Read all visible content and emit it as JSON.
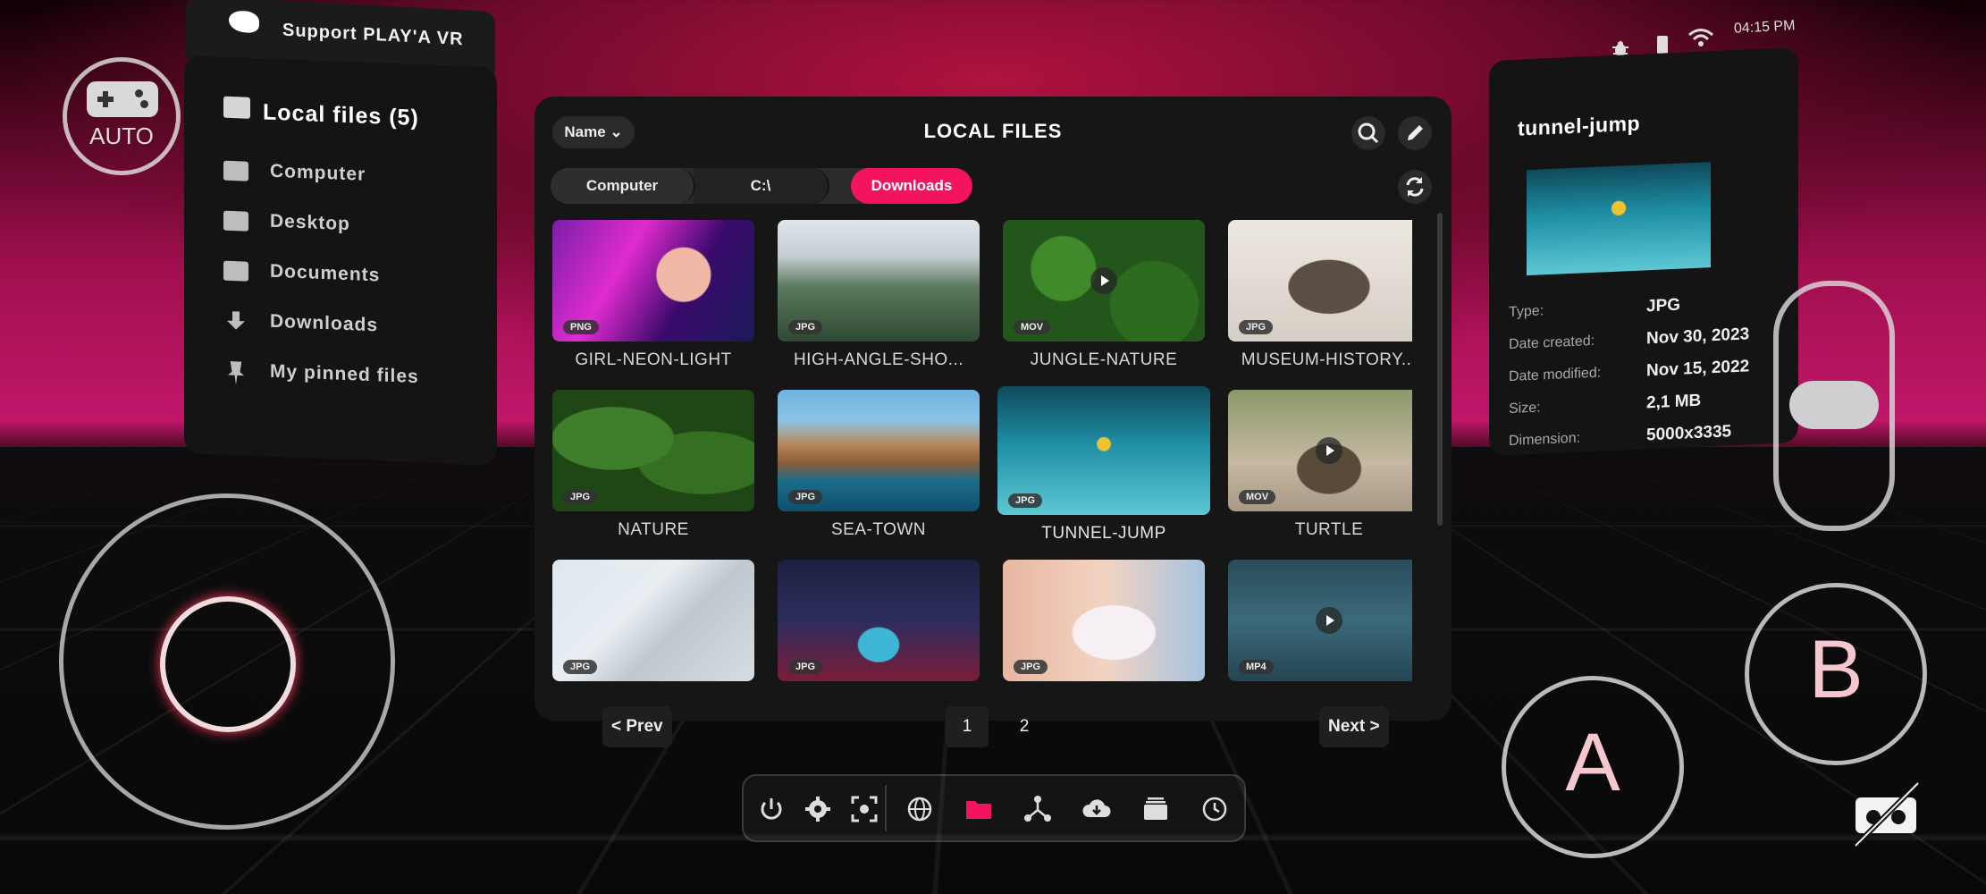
{
  "status_bar": {
    "time": "04:15 PM",
    "icons": [
      "bug-icon",
      "battery-icon",
      "wifi-icon"
    ]
  },
  "support": {
    "label": "Support PLAY'A VR",
    "icon": "patreon-icon"
  },
  "sidebar": {
    "title": "Local files (5)",
    "items": [
      {
        "label": "Computer",
        "icon": "monitor-icon"
      },
      {
        "label": "Desktop",
        "icon": "desktop-icon"
      },
      {
        "label": "Documents",
        "icon": "folder-icon"
      },
      {
        "label": "Downloads",
        "icon": "download-icon"
      },
      {
        "label": "My pinned files",
        "icon": "pin-icon"
      }
    ]
  },
  "browser": {
    "title": "LOCAL FILES",
    "sort_label": "Name",
    "breadcrumbs": [
      "Computer",
      "C:\\",
      "Downloads"
    ],
    "files": [
      {
        "name": "GIRL-NEON-LIGHT",
        "type": "PNG",
        "video": false
      },
      {
        "name": "HIGH-ANGLE-SHO...",
        "type": "JPG",
        "video": false
      },
      {
        "name": "JUNGLE-NATURE",
        "type": "MOV",
        "video": true
      },
      {
        "name": "MUSEUM-HISTORY...",
        "type": "JPG",
        "video": false
      },
      {
        "name": "NATURE",
        "type": "JPG",
        "video": false
      },
      {
        "name": "SEA-TOWN",
        "type": "JPG",
        "video": false
      },
      {
        "name": "TUNNEL-JUMP",
        "type": "JPG",
        "video": false,
        "selected": true
      },
      {
        "name": "TURTLE",
        "type": "MOV",
        "video": true
      },
      {
        "name": "",
        "type": "JPG",
        "video": false
      },
      {
        "name": "",
        "type": "JPG",
        "video": false
      },
      {
        "name": "",
        "type": "JPG",
        "video": false
      },
      {
        "name": "",
        "type": "MP4",
        "video": true
      }
    ],
    "pager": {
      "prev": "< Prev",
      "next": "Next >",
      "pages": [
        "1",
        "2"
      ],
      "current": "1"
    }
  },
  "details": {
    "title": "tunnel-jump",
    "rows": [
      {
        "key": "Type:",
        "value": "JPG"
      },
      {
        "key": "Date created:",
        "value": "Nov 30, 2023"
      },
      {
        "key": "Date modified:",
        "value": "Nov 15, 2022"
      },
      {
        "key": "Size:",
        "value": "2,1 MB"
      },
      {
        "key": "Dimension:",
        "value": "5000x3335"
      }
    ]
  },
  "dock": {
    "icons": [
      "power-icon",
      "settings-icon",
      "screenshot-icon",
      "globe-icon",
      "folder-icon",
      "network-icon",
      "cloud-download-icon",
      "library-icon",
      "history-icon"
    ],
    "active": "folder-icon",
    "accent": "#f4135d"
  },
  "controls": {
    "auto_label": "AUTO",
    "button_a": "A",
    "button_b": "B"
  }
}
